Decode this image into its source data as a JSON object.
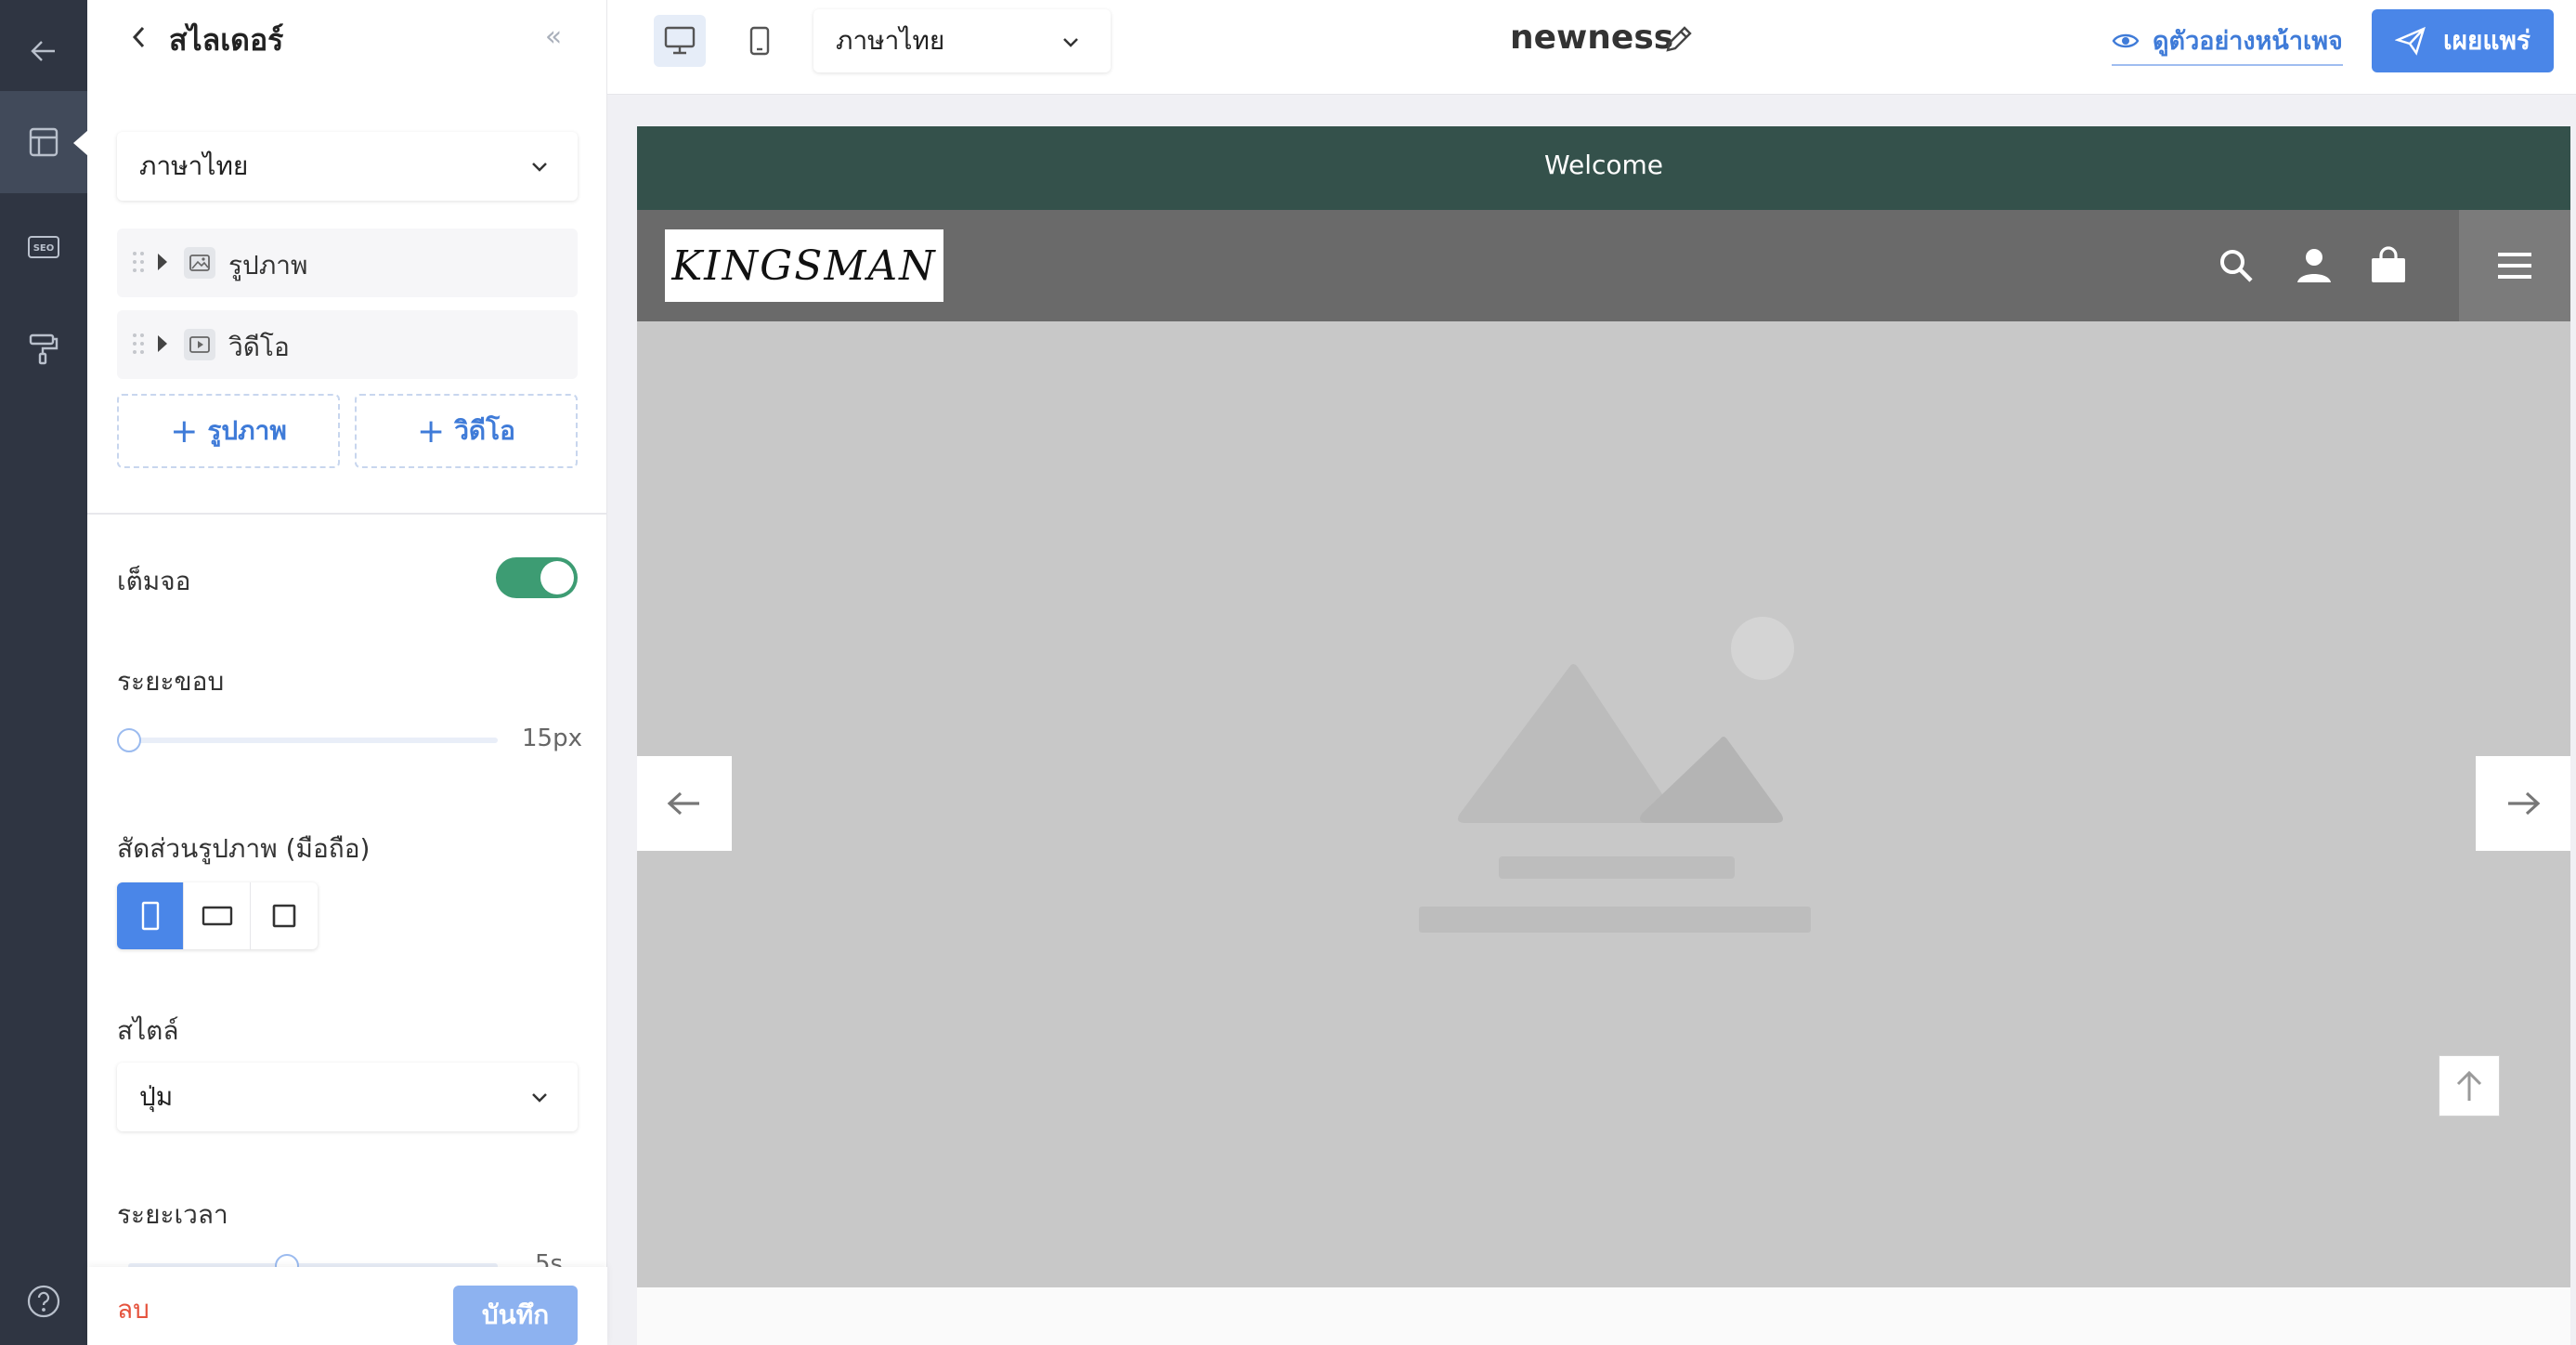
{
  "sidebar": {
    "help_icon": "question-circle-icon"
  },
  "panel": {
    "title": "สไลเดอร์",
    "language_select": "ภาษาไทย",
    "items": [
      {
        "label": "รูปภาพ",
        "icon": "image-icon"
      },
      {
        "label": "วิดีโอ",
        "icon": "video-icon"
      }
    ],
    "add_image_label": "รูปภาพ",
    "add_video_label": "วิดีโอ",
    "fullscreen_label": "เต็มจอ",
    "fullscreen_on": true,
    "padding_label": "ระยะขอบ",
    "padding_value": "15px",
    "aspect_label": "สัดส่วนรูปภาพ (มือถือ)",
    "aspect_selected": "portrait",
    "style_label": "สไตล์",
    "style_value": "ปุ่ม",
    "duration_label": "ระยะเวลา",
    "duration_value": "5s",
    "delete_label": "ลบ",
    "save_label": "บันทึก"
  },
  "topbar": {
    "language_select": "ภาษาไทย",
    "page_name": "newness",
    "preview_label": "ดูตัวอย่างหน้าเพจ",
    "publish_label": "เผยแพร่"
  },
  "preview": {
    "welcome_text": "Welcome",
    "logo_text": "KINGSMAN",
    "colors": {
      "welcome_bg": "#34514b",
      "nav_bg": "#6a6a6a",
      "accent": "#4a86e8"
    }
  }
}
